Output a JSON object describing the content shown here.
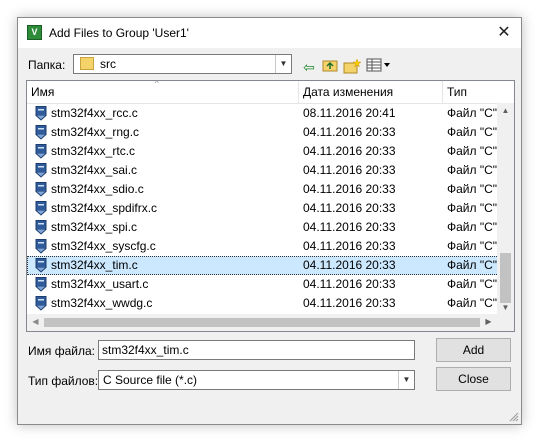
{
  "window": {
    "title": "Add Files to Group 'User1'",
    "app_icon_text": "V"
  },
  "lookin": {
    "label": "Папка:",
    "folder": "src"
  },
  "toolbar": {
    "icons": [
      "back-icon",
      "up-folder-icon",
      "new-folder-icon",
      "view-menu-icon"
    ]
  },
  "list": {
    "columns": [
      "Имя",
      "Дата изменения",
      "Тип"
    ],
    "rows": [
      {
        "name": "stm32f4xx_rcc.c",
        "date": "08.11.2016 20:41",
        "type": "Файл \"C\""
      },
      {
        "name": "stm32f4xx_rng.c",
        "date": "04.11.2016 20:33",
        "type": "Файл \"C\""
      },
      {
        "name": "stm32f4xx_rtc.c",
        "date": "04.11.2016 20:33",
        "type": "Файл \"C\""
      },
      {
        "name": "stm32f4xx_sai.c",
        "date": "04.11.2016 20:33",
        "type": "Файл \"C\""
      },
      {
        "name": "stm32f4xx_sdio.c",
        "date": "04.11.2016 20:33",
        "type": "Файл \"C\""
      },
      {
        "name": "stm32f4xx_spdifrx.c",
        "date": "04.11.2016 20:33",
        "type": "Файл \"C\""
      },
      {
        "name": "stm32f4xx_spi.c",
        "date": "04.11.2016 20:33",
        "type": "Файл \"C\""
      },
      {
        "name": "stm32f4xx_syscfg.c",
        "date": "04.11.2016 20:33",
        "type": "Файл \"C\""
      },
      {
        "name": "stm32f4xx_tim.c",
        "date": "04.11.2016 20:33",
        "type": "Файл \"C\"",
        "selected": true
      },
      {
        "name": "stm32f4xx_usart.c",
        "date": "04.11.2016 20:33",
        "type": "Файл \"C\""
      },
      {
        "name": "stm32f4xx_wwdg.c",
        "date": "04.11.2016 20:33",
        "type": "Файл \"C\""
      }
    ]
  },
  "filename": {
    "label": "Имя файла:",
    "value": "stm32f4xx_tim.c"
  },
  "filetype": {
    "label": "Тип файлов:",
    "value": "C Source file (*.c)"
  },
  "buttons": {
    "add": "Add",
    "close": "Close"
  },
  "colors": {
    "selection": "#cce8ff",
    "file_icon": "#2f5b9a"
  }
}
